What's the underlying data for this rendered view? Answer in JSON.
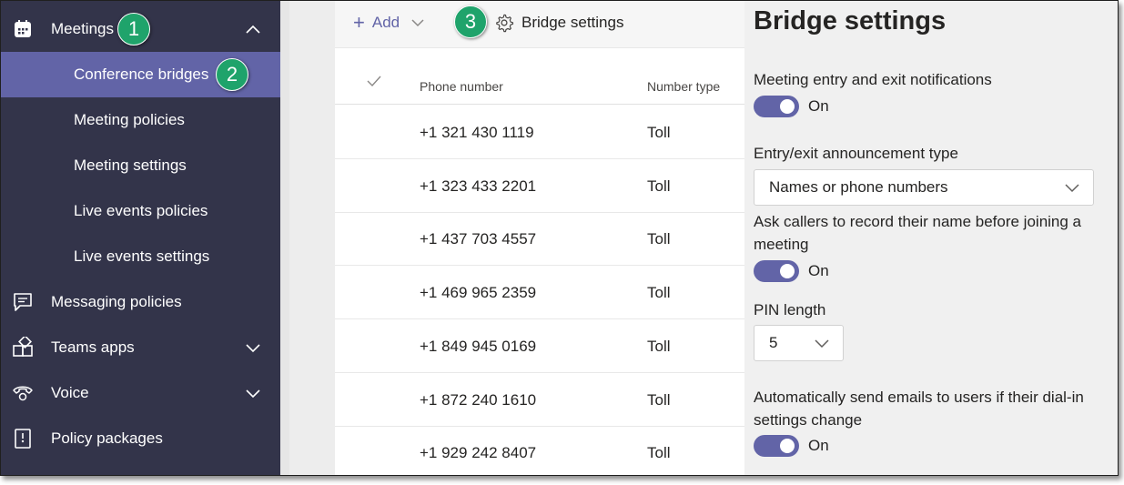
{
  "sidebar": {
    "items": [
      {
        "label": "Meetings",
        "icon": "calendar-icon",
        "expanded": true
      },
      {
        "label": "Conference bridges",
        "selected": true
      },
      {
        "label": "Meeting policies"
      },
      {
        "label": "Meeting settings"
      },
      {
        "label": "Live events policies"
      },
      {
        "label": "Live events settings"
      },
      {
        "label": "Messaging policies",
        "icon": "message-icon"
      },
      {
        "label": "Teams apps",
        "icon": "apps-icon"
      },
      {
        "label": "Voice",
        "icon": "phone-icon"
      },
      {
        "label": "Policy packages",
        "icon": "package-icon"
      }
    ]
  },
  "badges": [
    "1",
    "2",
    "3"
  ],
  "toolbar": {
    "add_label": "Add",
    "bridge_settings_label": "Bridge settings"
  },
  "table": {
    "columns": [
      "Phone number",
      "Number type"
    ],
    "rows": [
      {
        "phone": "+1 321 430 1119",
        "type": "Toll"
      },
      {
        "phone": "+1 323 433 2201",
        "type": "Toll"
      },
      {
        "phone": "+1 437 703 4557",
        "type": "Toll"
      },
      {
        "phone": "+1 469 965 2359",
        "type": "Toll"
      },
      {
        "phone": "+1 849 945 0169",
        "type": "Toll"
      },
      {
        "phone": "+1 872 240 1610",
        "type": "Toll"
      },
      {
        "phone": "+1 929 242 8407",
        "type": "Toll"
      }
    ]
  },
  "panel": {
    "title": "Bridge settings",
    "notifications_label": "Meeting entry and exit notifications",
    "notifications_state": "On",
    "announcement_label": "Entry/exit announcement type",
    "announcement_value": "Names or phone numbers",
    "record_name_label": "Ask callers to record their name before joining a meeting",
    "record_name_state": "On",
    "pin_label": "PIN length",
    "pin_value": "5",
    "email_label": "Automatically send emails to users if their dial-in settings change",
    "email_state": "On"
  },
  "colors": {
    "sidebar_bg": "#33344a",
    "accent": "#6264a7",
    "badge": "#1fa36b"
  }
}
